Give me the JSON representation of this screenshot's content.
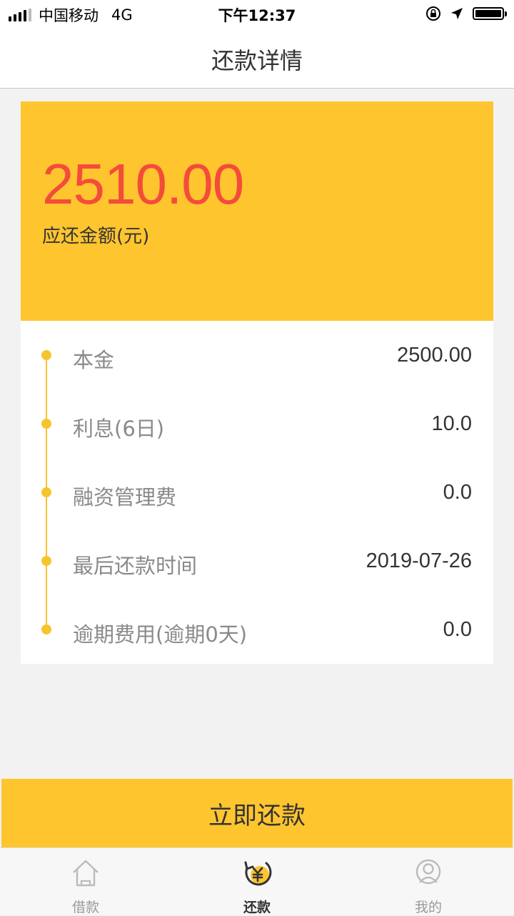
{
  "status_bar": {
    "carrier": "中国移动",
    "network": "4G",
    "time": "下午12:37"
  },
  "nav": {
    "title": "还款详情"
  },
  "amount": {
    "value": "2510.00",
    "label": "应还金额(元)"
  },
  "details": [
    {
      "label": "本金",
      "value": "2500.00"
    },
    {
      "label": "利息(6日)",
      "value": "10.0"
    },
    {
      "label": "融资管理费",
      "value": "0.0"
    },
    {
      "label": "最后还款时间",
      "value": "2019-07-26"
    },
    {
      "label": "逾期费用(逾期0天)",
      "value": "0.0"
    }
  ],
  "pay_button": {
    "label": "立即还款"
  },
  "tabs": [
    {
      "label": "借款",
      "icon": "home-icon",
      "active": false
    },
    {
      "label": "还款",
      "icon": "repay-yen-icon",
      "active": true
    },
    {
      "label": "我的",
      "icon": "user-icon",
      "active": false
    }
  ],
  "colors": {
    "accent": "#ffc52e",
    "amount": "#f44c3b",
    "timeline": "#f6c52e"
  }
}
